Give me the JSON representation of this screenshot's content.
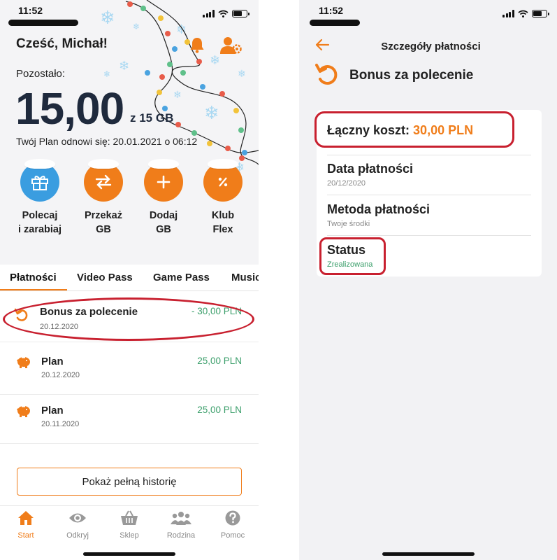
{
  "left_screen": {
    "status_time": "11:52",
    "greeting": "Cześć, Michał!",
    "remaining_label": "Pozostało:",
    "remaining_value": "15,00",
    "remaining_total": "z 15 GB",
    "renewal_text": "Twój Plan odnowi się: 20.01.2021 o 06:12",
    "icons": [
      "bell-icon",
      "user-settings-icon"
    ],
    "actions": [
      {
        "label": "Polecaj\ni zarabiaj",
        "icon": "gift-icon",
        "color": "#3a9de0"
      },
      {
        "label": "Przekaż\nGB",
        "icon": "transfer-icon",
        "color": "#f07d1a"
      },
      {
        "label": "Dodaj\nGB",
        "icon": "plus-icon",
        "color": "#f07d1a"
      },
      {
        "label": "Klub\nFlex",
        "icon": "percent-icon",
        "color": "#f07d1a"
      }
    ],
    "tabs": [
      "Płatności",
      "Video Pass",
      "Game Pass",
      "Music"
    ],
    "payments": [
      {
        "title": "Bonus za polecenie",
        "date": "20.12.2020",
        "amount": "- 30,00 PLN",
        "icon": "refund-icon"
      },
      {
        "title": "Plan",
        "date": "20.12.2020",
        "amount": "25,00 PLN",
        "icon": "piggy-bank-icon"
      },
      {
        "title": "Plan",
        "date": "20.11.2020",
        "amount": "25,00 PLN",
        "icon": "piggy-bank-icon"
      }
    ],
    "history_button": "Pokaż pełną historię",
    "nav": [
      {
        "label": "Start",
        "icon": "home-icon",
        "active": true
      },
      {
        "label": "Odkryj",
        "icon": "eye-icon",
        "active": false
      },
      {
        "label": "Sklep",
        "icon": "basket-icon",
        "active": false
      },
      {
        "label": "Rodzina",
        "icon": "family-icon",
        "active": false
      },
      {
        "label": "Pomoc",
        "icon": "help-icon",
        "active": false
      }
    ]
  },
  "right_screen": {
    "status_time": "11:52",
    "title": "Szczegóły płatności",
    "heading": "Bonus za polecenie",
    "total_cost_label": "Łączny koszt:",
    "total_cost_value": "30,00 PLN",
    "payment_date_label": "Data płatności",
    "payment_date_value": "20/12/2020",
    "payment_method_label": "Metoda płatności",
    "payment_method_value": "Twoje środki",
    "status_label": "Status",
    "status_value": "Zrealizowana"
  },
  "colors": {
    "accent": "#f07d1a",
    "positive": "#3a9e6a",
    "highlight": "#c8202f",
    "dark_text": "#1f2a3d"
  }
}
